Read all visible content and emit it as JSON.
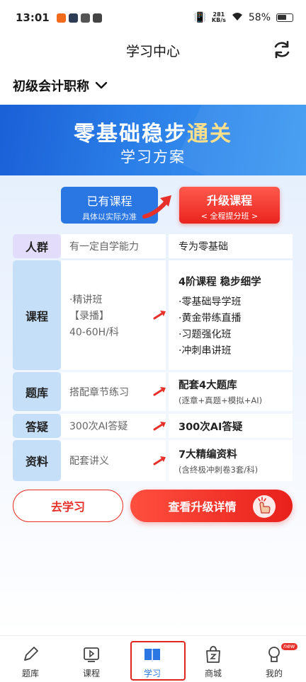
{
  "status": {
    "time": "13:01",
    "net_speed": "281",
    "net_unit": "KB/s",
    "battery": "58%"
  },
  "header": {
    "title": "学习中心"
  },
  "exam": {
    "name": "初级会计职称"
  },
  "banner": {
    "title_a": "零基础稳步",
    "title_b": "通关",
    "subtitle": "学习方案"
  },
  "compare": {
    "current": {
      "title": "已有课程",
      "sub": "具体以实际为准"
    },
    "upgrade": {
      "title": "升级课程",
      "sub": "< 全程提分班 >"
    }
  },
  "table": {
    "crowd": {
      "cat": "人群",
      "current": "有一定自学能力",
      "upgrade": "专为零基础"
    },
    "course": {
      "cat": "课程",
      "current": [
        "·精讲班",
        "【录播】",
        "40-60H/科"
      ],
      "upgrade_title": "4阶课程 稳步细学",
      "upgrade_items": [
        "·零基础导学班",
        "·黄金带练直播",
        "·习题强化班",
        "·冲刺串讲班"
      ]
    },
    "bank": {
      "cat": "题库",
      "current": "搭配章节练习",
      "upgrade_title": "配套4大题库",
      "upgrade_note": "(逐章+真题+模拟+AI)"
    },
    "qa": {
      "cat": "答疑",
      "current": "300次AI答疑",
      "upgrade_title": "300次AI答疑"
    },
    "material": {
      "cat": "资料",
      "current": "配套讲义",
      "upgrade_title": "7大精编资料",
      "upgrade_note": "(含终极冲刺卷3套/科)"
    }
  },
  "actions": {
    "study": "去学习",
    "upgrade": "查看升级详情"
  },
  "nav": [
    {
      "label": "题库",
      "icon": "pencil-icon"
    },
    {
      "label": "课程",
      "icon": "play-icon"
    },
    {
      "label": "学习",
      "icon": "book-icon"
    },
    {
      "label": "商城",
      "icon": "bag-icon"
    },
    {
      "label": "我的",
      "icon": "user-icon"
    }
  ],
  "nav_badge": "new",
  "colors": {
    "primary": "#2a77e4",
    "accent": "#e8302a"
  }
}
